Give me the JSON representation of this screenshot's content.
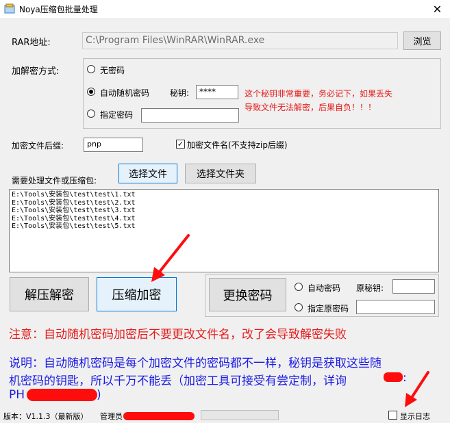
{
  "window": {
    "title": "Noya压缩包批量处理",
    "close_glyph": "✕"
  },
  "rar": {
    "label": "RAR地址:",
    "path": "C:\\Program Files\\WinRAR\\WinRAR.exe",
    "browse_label": "浏览"
  },
  "encrypt_mode": {
    "label": "加解密方式:",
    "no_password_label": "无密码",
    "auto_random_label": "自动随机密码",
    "secret_key_label": "秘钥:",
    "secret_key_value": "****",
    "fixed_password_label": "指定密码",
    "fixed_password_value": "",
    "selected": "auto_random",
    "warning_line1": "这个秘钥非常重要，务必记下，如果丢失",
    "warning_line2": "导致文件无法解密，后果自负！！！"
  },
  "suffix": {
    "label": "加密文件后缀:",
    "value": "pnp",
    "encrypt_filename_label": "加密文件名(不支持zip后缀)",
    "encrypt_filename_checked": true
  },
  "files": {
    "label": "需要处理文件或压缩包:",
    "select_file_label": "选择文件",
    "select_folder_label": "选择文件夹",
    "items": [
      "E:\\Tools\\安装包\\test\\test\\1.txt",
      "E:\\Tools\\安装包\\test\\test\\2.txt",
      "E:\\Tools\\安装包\\test\\test\\3.txt",
      "E:\\Tools\\安装包\\test\\test\\4.txt",
      "E:\\Tools\\安装包\\test\\test\\5.txt"
    ]
  },
  "actions": {
    "decompress_label": "解压解密",
    "compress_label": "压缩加密",
    "change_password_label": "更换密码",
    "auto_password_label": "自动密码",
    "orig_key_label": "原秘钥:",
    "orig_key_value": "",
    "specify_orig_label": "指定原密码",
    "specify_orig_value": ""
  },
  "notes": {
    "warning": "注意：自动随机密码加密后不要更改文件名，改了会导致解密失败",
    "info_line1": "说明：自动随机密码是每个加密文件的密码都不一样，秘钥是获取这些随",
    "info_line2": "机密码的钥匙，所以千万不能丢（加密工具可接受有尝定制，详询",
    "info_line2_tail": ":",
    "info_line3": "PH",
    "info_line3_tail": ")"
  },
  "status": {
    "version": "版本：V1.1.3（最新版）",
    "admin_label": "管理员",
    "show_log_label": "显示日志",
    "show_log_checked": false
  },
  "colors": {
    "warning_red": "#e61a1a",
    "info_blue": "#1a1ae6",
    "annotation_red": "#ff0d0d"
  }
}
